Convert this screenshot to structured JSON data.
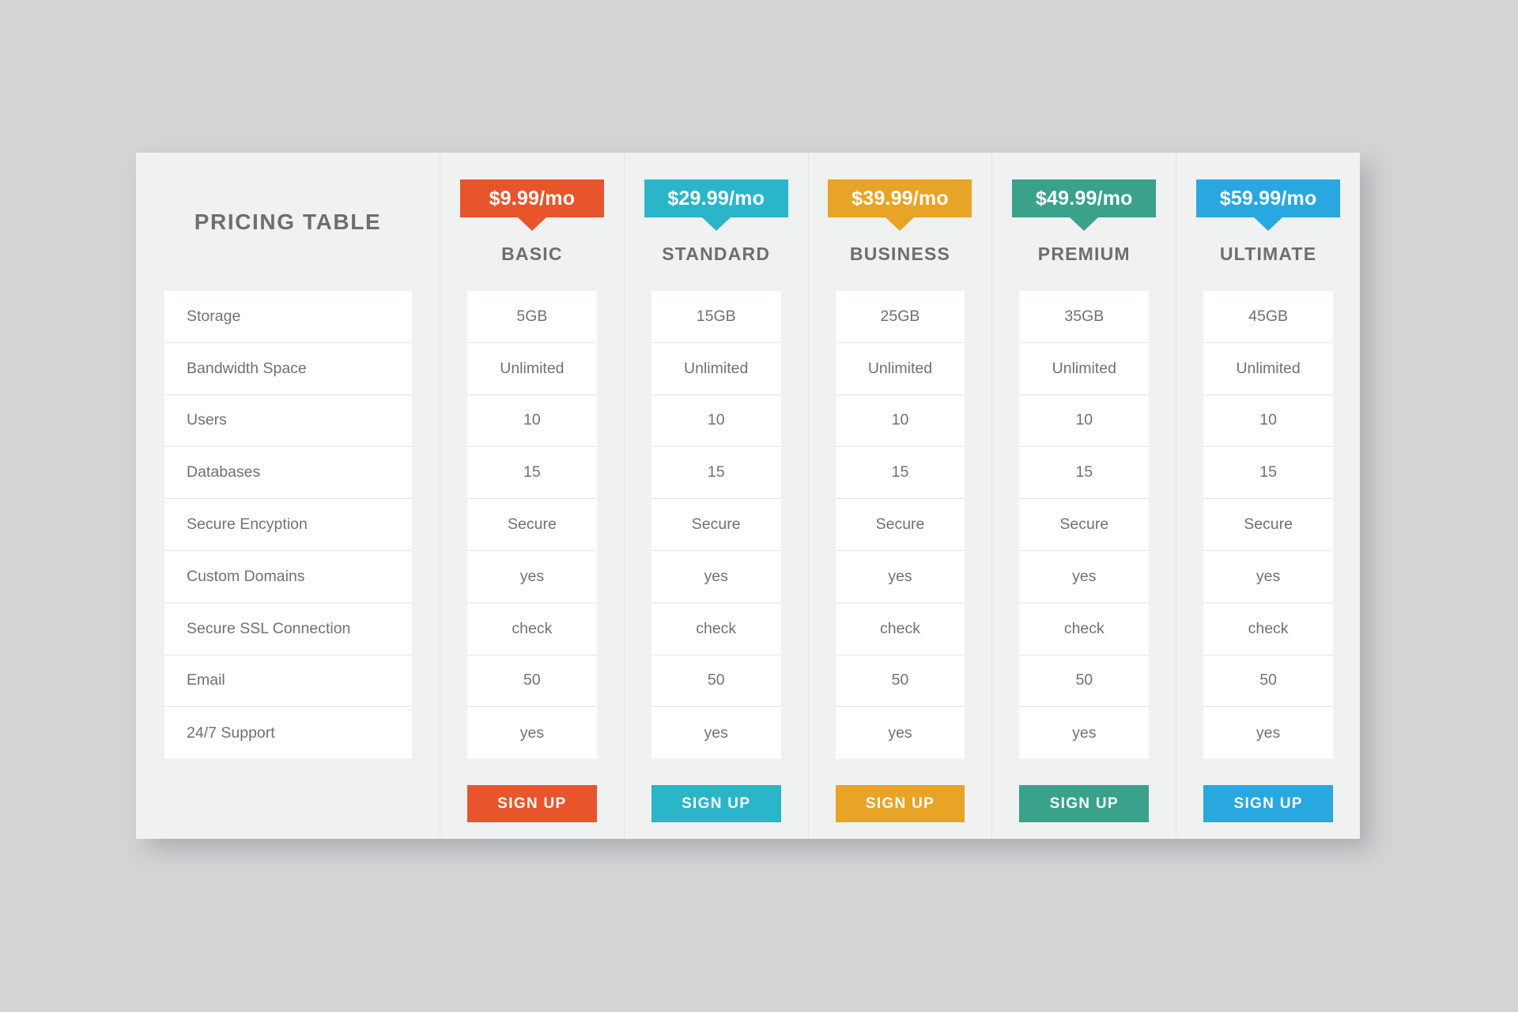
{
  "page": {
    "background_color": "#d3d4d6",
    "card_background": "#f0f1f1"
  },
  "header": {
    "title": "PRICING TABLE"
  },
  "features": [
    "Storage",
    "Bandwidth Space",
    "Users",
    "Databases",
    "Secure Encyption",
    "Custom Domains",
    "Secure SSL Connection",
    "Email",
    "24/7 Support"
  ],
  "signup_label": "SIGN UP",
  "plans": [
    {
      "name": "BASIC",
      "price": "$9.99/mo",
      "color": "#e8552d",
      "values": [
        "5GB",
        "Unlimited",
        "10",
        "15",
        "Secure",
        "yes",
        "check",
        "50",
        "yes"
      ]
    },
    {
      "name": "STANDARD",
      "price": "$29.99/mo",
      "color": "#2bb5c8",
      "values": [
        "15GB",
        "Unlimited",
        "10",
        "15",
        "Secure",
        "yes",
        "check",
        "50",
        "yes"
      ]
    },
    {
      "name": "BUSINESS",
      "price": "$39.99/mo",
      "color": "#e8a426",
      "values": [
        "25GB",
        "Unlimited",
        "10",
        "15",
        "Secure",
        "yes",
        "check",
        "50",
        "yes"
      ]
    },
    {
      "name": "PREMIUM",
      "price": "$49.99/mo",
      "color": "#3aa18b",
      "values": [
        "35GB",
        "Unlimited",
        "10",
        "15",
        "Secure",
        "yes",
        "check",
        "50",
        "yes"
      ]
    },
    {
      "name": "ULTIMATE",
      "price": "$59.99/mo",
      "color": "#29a8e0",
      "values": [
        "45GB",
        "Unlimited",
        "10",
        "15",
        "Secure",
        "yes",
        "check",
        "50",
        "yes"
      ]
    }
  ]
}
